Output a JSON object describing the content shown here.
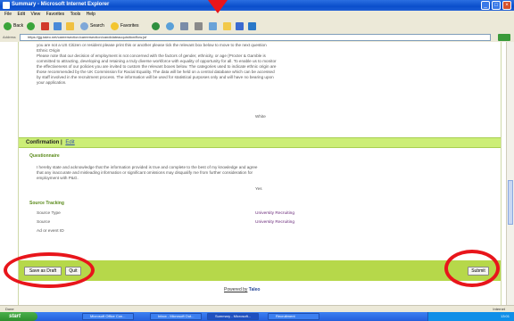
{
  "window": {
    "title": "Summary - Microsoft Internet Explorer"
  },
  "menu": [
    "File",
    "Edit",
    "View",
    "Favorites",
    "Tools",
    "Help"
  ],
  "toolbar": {
    "back": "Back",
    "search": "Search",
    "favorites": "Favorites"
  },
  "address": {
    "label": "Address",
    "url": "https://jjg.taleo.net/careersection/careersection/candidateacquisition/flow.jsf"
  },
  "top_section": {
    "text": "you are not a US Citizen or resident please print this or another please tick the relevant box below to move to the next question\nEthnic Origin\nPlease note that our decision of employment is not concerned with the factors of gender, ethnicity, or age (Procter & Gamble is committed to attracting, developing and retaining a truly diverse workforce with equality of opportunity for all. To enable us to monitor the effectiveness of our policies you are invited to custom the relevant boxes below. The categories used to indicate ethnic origin are those recommended by the UK Commission for Racial Equality. The data will be held on a central database which can be accessed by staff involved in the recruitment process. The information will be used for statistical purposes only and will have no bearing upon your application.",
    "value": "White"
  },
  "confirmation": {
    "heading": "Confirmation",
    "edit": "Edit",
    "questionnaire_label": "Questionnaire",
    "statement": "I hereby state and acknowledge that the information provided is true and complete to the best of my knowledge and agree that any inaccurate and misleading information or significant omissions may disqualify me from further consideration for employment with P&G.",
    "statement_value": "Yes",
    "source_tracking_label": "Source Tracking",
    "rows": [
      {
        "label": "Source Type",
        "value": "University Recruiting"
      },
      {
        "label": "Source",
        "value": "University Recruiting"
      },
      {
        "label": "Ad or event ID",
        "value": ""
      }
    ]
  },
  "actions": {
    "save_draft": "Save as Draft",
    "quit": "Quit",
    "submit": "Submit"
  },
  "footer": {
    "powered_by": "Powered by",
    "brand": "Taleo"
  },
  "status": {
    "left": "Done",
    "right": "Internet"
  },
  "taskbar": {
    "start": "start",
    "tasks": [
      "Microsoft Office Con...",
      "Inbox - Microsoft Out...",
      "Summary - Microsoft...",
      "Recruitment"
    ],
    "clock": "13:01"
  }
}
